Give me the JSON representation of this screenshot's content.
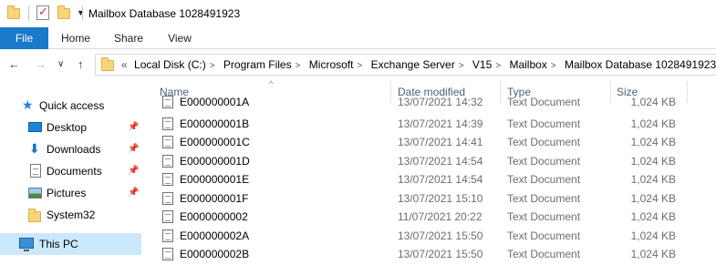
{
  "window": {
    "title": "Mailbox Database 1028491923",
    "quick_access_toolbar": {
      "icons": [
        "folder-icon",
        "properties-icon",
        "new-folder-icon",
        "customize-dropdown-icon"
      ]
    }
  },
  "ribbon": {
    "tabs": [
      {
        "label": "File",
        "active": true
      },
      {
        "label": "Home"
      },
      {
        "label": "Share"
      },
      {
        "label": "View"
      }
    ],
    "accent_color": "#1979ca"
  },
  "navigation": {
    "back_glyph": "←",
    "forward_glyph": "→",
    "recent_glyph": "∨",
    "up_glyph": "↑",
    "overflow_glyph": "«",
    "breadcrumb": [
      "Local Disk (C:)",
      "Program Files",
      "Microsoft",
      "Exchange Server",
      "V15",
      "Mailbox",
      "Mailbox Database 1028491923"
    ]
  },
  "sidebar": {
    "items": [
      {
        "label": "Quick access",
        "icon": "star-icon",
        "pinned": false
      },
      {
        "label": "Desktop",
        "icon": "desktop-icon",
        "pinned": true
      },
      {
        "label": "Downloads",
        "icon": "download-icon",
        "pinned": true
      },
      {
        "label": "Documents",
        "icon": "documents-icon",
        "pinned": true
      },
      {
        "label": "Pictures",
        "icon": "pictures-icon",
        "pinned": true
      },
      {
        "label": "System32",
        "icon": "folder-icon",
        "pinned": false
      },
      {
        "label": "This PC",
        "icon": "pc-icon",
        "pinned": false,
        "selected": true
      }
    ],
    "pin_glyph": "📌",
    "selected_color": "#cce8ff"
  },
  "file_list": {
    "columns": [
      "Name",
      "Date modified",
      "Type",
      "Size"
    ],
    "sort_glyph": "^",
    "rows": [
      {
        "name": "E000000001A",
        "date": "13/07/2021 14:32",
        "type": "Text Document",
        "size": "1,024 KB"
      },
      {
        "name": "E000000001B",
        "date": "13/07/2021 14:39",
        "type": "Text Document",
        "size": "1,024 KB"
      },
      {
        "name": "E000000001C",
        "date": "13/07/2021 14:41",
        "type": "Text Document",
        "size": "1,024 KB"
      },
      {
        "name": "E000000001D",
        "date": "13/07/2021 14:54",
        "type": "Text Document",
        "size": "1,024 KB"
      },
      {
        "name": "E000000001E",
        "date": "13/07/2021 14:54",
        "type": "Text Document",
        "size": "1,024 KB"
      },
      {
        "name": "E000000001F",
        "date": "13/07/2021 15:10",
        "type": "Text Document",
        "size": "1,024 KB"
      },
      {
        "name": "E0000000002",
        "date": "11/07/2021 20:22",
        "type": "Text Document",
        "size": "1,024 KB"
      },
      {
        "name": "E000000002A",
        "date": "13/07/2021 15:50",
        "type": "Text Document",
        "size": "1,024 KB"
      },
      {
        "name": "E000000002B",
        "date": "13/07/2021 15:50",
        "type": "Text Document",
        "size": "1,024 KB"
      }
    ]
  }
}
